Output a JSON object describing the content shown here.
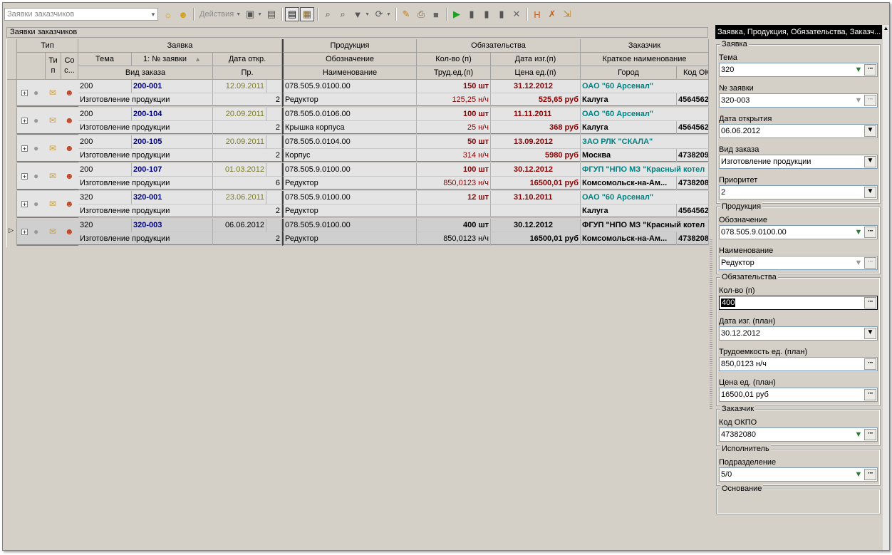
{
  "toolbar": {
    "view_combo": "Заявки заказчиков",
    "actions_label": "Действия"
  },
  "grid": {
    "title": "Заявки заказчиков",
    "group_headers": [
      "Тип",
      "Заявка",
      "Продукция",
      "Обязательства",
      "Заказчик"
    ],
    "col_headers": {
      "tip_short": "Ти п",
      "sos_short": "Со с...",
      "tema": "Тема",
      "nomer": "1: № заявки",
      "data_otkr": "Дата откр.",
      "vid_zakaza": "Вид заказа",
      "pr": "Пр.",
      "oboznach": "Обозначение",
      "naimen": "Наименование",
      "kol": "Кол-во (п)",
      "data_izg": "Дата изг.(п)",
      "trud": "Труд.ед.(п)",
      "cena": "Цена ед.(п)",
      "kratk": "Краткое наименование",
      "gorod": "Город",
      "kod": "Код ОК"
    },
    "rows": [
      {
        "tema": "200",
        "nomer": "200-001",
        "data_otkr": "12.09.2011",
        "vid": "Изготовление продукции",
        "pr": "2",
        "oboz": "078.505.9.0100.00",
        "naim": "Редуктор",
        "kol": "150 шт",
        "data_izg": "31.12.2012",
        "trud": "125,25 н/ч",
        "cena": "525,65 руб",
        "kratk": "ОАО \"60 Арсенал\"",
        "gorod": "Калуга",
        "kod": "4564562"
      },
      {
        "tema": "200",
        "nomer": "200-104",
        "data_otkr": "20.09.2011",
        "vid": "Изготовление продукции",
        "pr": "2",
        "oboz": "078.505.0.0106.00",
        "naim": "Крышка корпуса",
        "kol": "100 шт",
        "data_izg": "11.11.2011",
        "trud": "25 н/ч",
        "cena": "368 руб",
        "kratk": "ОАО \"60 Арсенал\"",
        "gorod": "Калуга",
        "kod": "4564562"
      },
      {
        "tema": "200",
        "nomer": "200-105",
        "data_otkr": "20.09.2011",
        "vid": "Изготовление продукции",
        "pr": "2",
        "oboz": "078.505.0.0104.00",
        "naim": "Корпус",
        "kol": "50 шт",
        "data_izg": "13.09.2012",
        "trud": "314 н/ч",
        "cena": "5980 руб",
        "kratk": "ЗАО РЛК \"СКАЛА\"",
        "gorod": "Москва",
        "kod": "4738209"
      },
      {
        "tema": "200",
        "nomer": "200-107",
        "data_otkr": "01.03.2012",
        "vid": "Изготовление продукции",
        "pr": "6",
        "oboz": "078.505.9.0100.00",
        "naim": "Редуктор",
        "kol": "100 шт",
        "data_izg": "30.12.2012",
        "trud": "850,0123 н/ч",
        "cena": "16500,01 руб",
        "kratk": "ФГУП \"НПО МЗ \"Красный котел",
        "gorod": "Комсомольск-на-Ам...",
        "kod": "4738208"
      },
      {
        "tema": "320",
        "nomer": "320-001",
        "data_otkr": "23.06.2011",
        "vid": "Изготовление продукции",
        "pr": "2",
        "oboz": "078.505.9.0100.00",
        "naim": "Редуктор",
        "kol": "12 шт",
        "data_izg": "31.10.2011",
        "trud": "",
        "cena": "",
        "kratk": "ОАО \"60 Арсенал\"",
        "gorod": "Калуга",
        "kod": "4564562"
      },
      {
        "tema": "320",
        "nomer": "320-003",
        "data_otkr": "06.06.2012",
        "vid": "Изготовление продукции",
        "pr": "2",
        "oboz": "078.505.9.0100.00",
        "naim": "Редуктор",
        "kol": "400 шт",
        "data_izg": "30.12.2012",
        "trud": "850,0123 н/ч",
        "cena": "16500,01 руб",
        "kratk": "ФГУП \"НПО МЗ \"Красный котел",
        "gorod": "Комсомольск-на-Ам...",
        "kod": "4738208"
      }
    ]
  },
  "detail": {
    "title": "Заявка, Продукция, Обязательства, Заказч...",
    "groups": {
      "zayavka": "Заявка",
      "produkciya": "Продукция",
      "obyaz": "Обязательства",
      "zakazchik": "Заказчик",
      "ispolnitel": "Исполнитель",
      "osnovanie": "Основание"
    },
    "fields": {
      "tema_label": "Тема",
      "tema": "320",
      "nomer_label": "№ заявки",
      "nomer": "320-003",
      "data_label": "Дата открытия",
      "data": "06.06.2012",
      "vid_label": "Вид заказа",
      "vid": "Изготовление продукции",
      "prior_label": "Приоритет",
      "prior": "2",
      "oboz_label": "Обозначение",
      "oboz": "078.505.9.0100.00",
      "naim_label": "Наименование",
      "naim": "Редуктор",
      "kol_label": "Кол-во (п)",
      "kol": "400",
      "dataizg_label": "Дата изг. (план)",
      "dataizg": "30.12.2012",
      "trud_label": "Трудоемкость ед. (план)",
      "trud": "850,0123 н/ч",
      "cena_label": "Цена ед. (план)",
      "cena": "16500,01 руб",
      "okpo_label": "Код ОКПО",
      "okpo": "47382080",
      "podr_label": "Подразделение",
      "podr": "5/0"
    }
  }
}
